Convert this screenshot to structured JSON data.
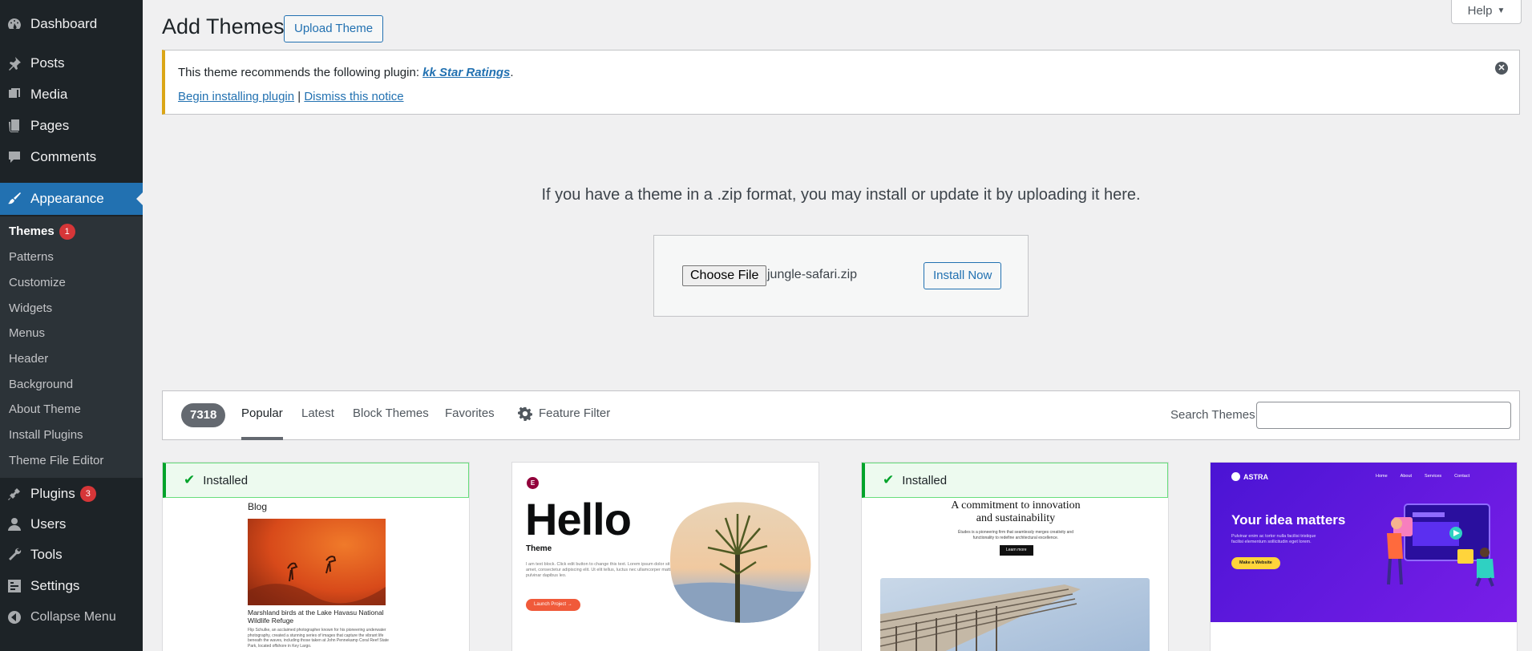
{
  "sidebar": {
    "items": [
      {
        "label": "Dashboard",
        "icon": "dashboard-icon"
      },
      {
        "label": "Posts",
        "icon": "pin-icon"
      },
      {
        "label": "Media",
        "icon": "media-icon"
      },
      {
        "label": "Pages",
        "icon": "pages-icon"
      },
      {
        "label": "Comments",
        "icon": "comment-icon"
      },
      {
        "label": "Appearance",
        "icon": "paintbrush-icon"
      },
      {
        "label": "Plugins",
        "icon": "plugin-icon",
        "badge": "3"
      },
      {
        "label": "Users",
        "icon": "users-icon"
      },
      {
        "label": "Tools",
        "icon": "wrench-icon"
      },
      {
        "label": "Settings",
        "icon": "settings-icon"
      },
      {
        "label": "Collapse Menu",
        "icon": "collapse-icon"
      }
    ],
    "submenu": [
      {
        "label": "Themes",
        "badge": "1"
      },
      {
        "label": "Patterns"
      },
      {
        "label": "Customize"
      },
      {
        "label": "Widgets"
      },
      {
        "label": "Menus"
      },
      {
        "label": "Header"
      },
      {
        "label": "Background"
      },
      {
        "label": "About Theme"
      },
      {
        "label": "Install Plugins"
      },
      {
        "label": "Theme File Editor"
      }
    ]
  },
  "header": {
    "title": "Add Themes",
    "upload_button": "Upload Theme",
    "help": "Help"
  },
  "notice": {
    "text": "This theme recommends the following plugin: ",
    "plugin_link": "kk Star Ratings",
    "period": ".",
    "begin_link": "Begin installing plugin",
    "separator": " | ",
    "dismiss_link": "Dismiss this notice"
  },
  "upload": {
    "description": "If you have a theme in a .zip format, you may install or update it by uploading it here.",
    "choose_file": "Choose File",
    "file_name": "jungle-safari.zip",
    "install_button": "Install Now"
  },
  "filters": {
    "count": "7318",
    "tabs": [
      "Popular",
      "Latest",
      "Block Themes",
      "Favorites"
    ],
    "feature_filter": "Feature Filter",
    "search_label": "Search Themes",
    "search_value": ""
  },
  "themes": [
    {
      "installed": "Installed",
      "blog_title": "Blog",
      "caption": "Marshland birds at the Lake Havasu National Wildlife Refuge",
      "body": "Flip Schulke, an acclaimed photographer known for his pioneering underwater photography, created a stunning series of images that capture the vibrant life beneath the waves, including those taken at John Pennekamp Coral Reef State Park, located offshore in Key Largo."
    },
    {
      "hello_title": "Hello",
      "hello_subtitle": "Theme",
      "hello_body": "I am text block. Click edit button to change this text. Lorem ipsum dolor sit amet, consectetur adipiscing elit. Ut elit tellus, luctus nec ullamcorper mattis, pulvinar dapibus leo.",
      "hello_button": "Launch Project  →"
    },
    {
      "installed": "Installed",
      "headline": "A commitment to innovation and sustainability",
      "subtext": "Études is a pioneering firm that seamlessly merges creativity and functionality to redefine architectural excellence.",
      "button": "Learn more"
    },
    {
      "brand": "ASTRA",
      "nav": [
        "Home",
        "About",
        "Services",
        "Contact"
      ],
      "headline": "Your idea matters",
      "subtext": "Pulvinar enim ac tortor nulla facilisi tristique facilisi elementum sollicitudin eget lorem.",
      "button": "Make a Website"
    }
  ],
  "colors": {
    "sidebar_bg": "#1d2327",
    "accent": "#2271b1",
    "badge": "#d63638",
    "installed_green": "#00a32a",
    "notice_warning": "#dba617",
    "astra_purple": "#6b12e8"
  }
}
